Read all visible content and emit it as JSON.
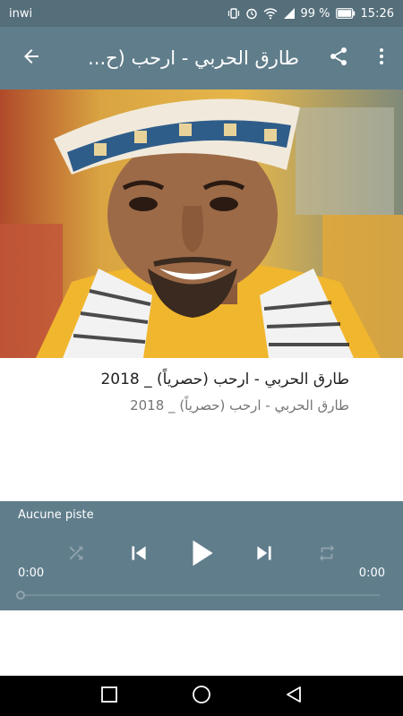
{
  "status_bar": {
    "carrier": "inwi",
    "battery": "99 %",
    "time": "15:26",
    "icons": [
      "vibrate-icon",
      "alarm-icon",
      "wifi-icon",
      "signal-icon",
      "battery-icon"
    ]
  },
  "app_bar": {
    "title": "طارق الحربي - ارحب (ح...",
    "back_icon": "arrow-back-icon",
    "share_icon": "share-icon",
    "more_icon": "more-vert-icon"
  },
  "track": {
    "title": "طارق الحربي - ارحب (حصرياً) _ 2018",
    "subtitle": "طارق الحربي - ارحب (حصرياً) _ 2018"
  },
  "player": {
    "status": "Aucune piste",
    "time_elapsed": "0:00",
    "time_total": "0:00",
    "progress": 0,
    "controls": [
      "shuffle-icon",
      "skip-previous-icon",
      "play-icon",
      "skip-next-icon",
      "repeat-icon"
    ]
  },
  "nav_bar": {
    "buttons": [
      "recents-icon",
      "home-icon",
      "back-icon"
    ]
  },
  "colors": {
    "primary": "#607d8b",
    "primary_dark": "#546e7a",
    "text_primary": "#212121",
    "text_secondary": "#757575"
  }
}
